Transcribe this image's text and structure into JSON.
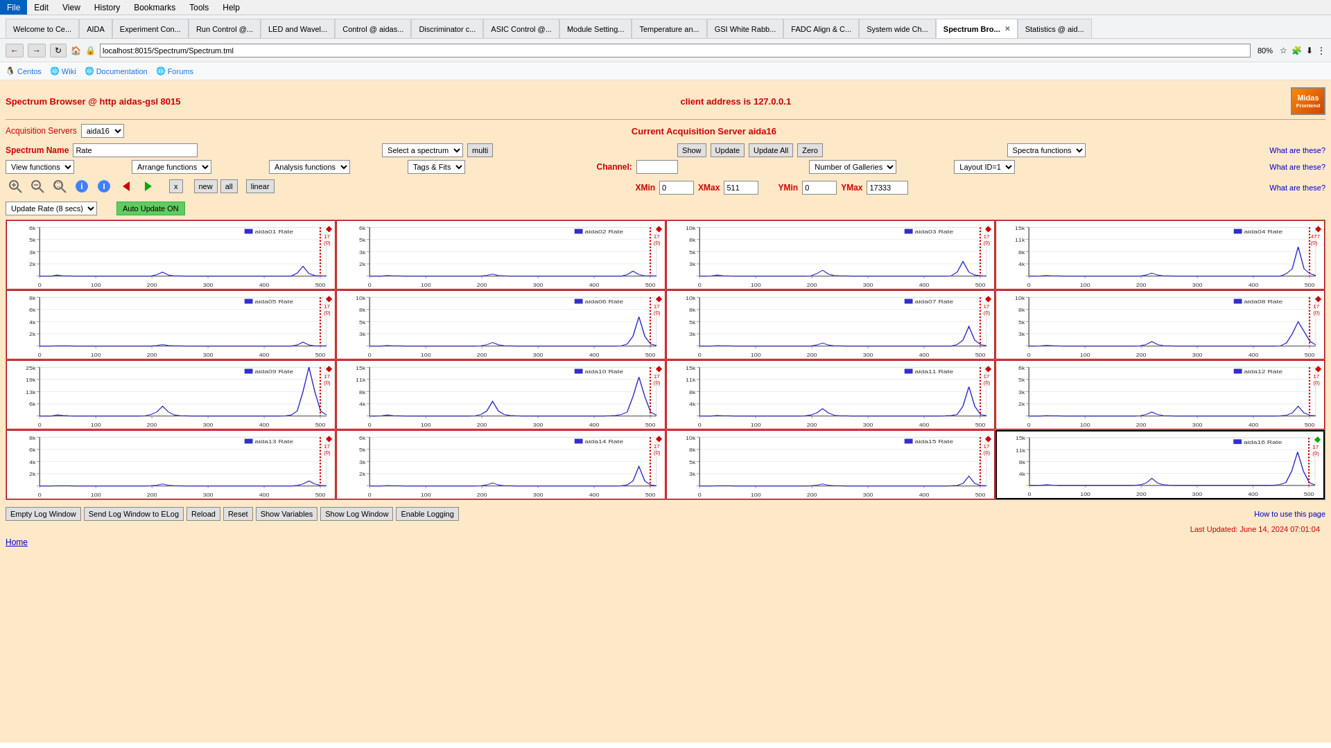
{
  "menu": {
    "items": [
      "File",
      "Edit",
      "View",
      "History",
      "Bookmarks",
      "Tools",
      "Help"
    ]
  },
  "tabs": [
    {
      "label": "Welcome to Ce...",
      "active": false
    },
    {
      "label": "AIDA",
      "active": false
    },
    {
      "label": "Experiment Con...",
      "active": false
    },
    {
      "label": "Run Control @...",
      "active": false
    },
    {
      "label": "LED and Wavel...",
      "active": false
    },
    {
      "label": "Control @ aidas...",
      "active": false
    },
    {
      "label": "Discriminator c...",
      "active": false
    },
    {
      "label": "ASIC Control @...",
      "active": false
    },
    {
      "label": "Module Setting...",
      "active": false
    },
    {
      "label": "Temperature an...",
      "active": false
    },
    {
      "label": "GSI White Rabb...",
      "active": false
    },
    {
      "label": "FADC Align & C...",
      "active": false
    },
    {
      "label": "System wide Ch...",
      "active": false
    },
    {
      "label": "Spectrum Bro...",
      "active": true,
      "closable": true
    },
    {
      "label": "Statistics @ aid...",
      "active": false
    }
  ],
  "nav": {
    "url": "localhost:8015/Spectrum/Spectrum.tml",
    "zoom": "80%"
  },
  "bookmarks": [
    {
      "label": "Centos"
    },
    {
      "label": "Wiki"
    },
    {
      "label": "Documentation"
    },
    {
      "label": "Forums"
    }
  ],
  "page": {
    "title": "Spectrum Browser @ http aidas-gsl 8015",
    "client_address": "client address is 127.0.0.1",
    "acq_label": "Acquisition Servers",
    "acq_server_select": "aida16",
    "current_acq": "Current Acquisition Server aida16",
    "spectrum_name_label": "Spectrum Name",
    "spectrum_name_value": "Rate",
    "select_spectrum": "Select a spectrum",
    "multi_btn": "multi",
    "show_btn": "Show",
    "update_btn": "Update",
    "update_all_btn": "Update All",
    "zero_btn": "Zero",
    "spectra_functions": "Spectra functions",
    "what_these1": "What are these?",
    "view_functions": "View functions",
    "arrange_functions": "Arrange functions",
    "analysis_functions": "Analysis functions",
    "tags_fits": "Tags & Fits",
    "channel_label": "Channel:",
    "channel_value": "",
    "number_galleries": "Number of Galleries",
    "layout_id": "Layout ID=1",
    "what_these2": "What are these?",
    "xmin_label": "XMin",
    "xmin_value": "0",
    "xmax_label": "XMax",
    "xmax_value": "511",
    "ymin_label": "YMin",
    "ymin_value": "0",
    "ymax_label": "YMax",
    "ymax_value": "17333",
    "what_these3": "What are these?",
    "update_rate": "Update Rate (8 secs)",
    "auto_update": "Auto Update ON",
    "btn_x": "x",
    "btn_new": "new",
    "btn_all": "all",
    "btn_linear": "linear",
    "bottom_btns": [
      "Empty Log Window",
      "Send Log Window to ELog",
      "Reload",
      "Reset",
      "Show Variables",
      "Show Log Window",
      "Enable Logging"
    ],
    "how_to": "How to use this page",
    "last_updated": "Last Updated: June 14, 2024 07:01:04",
    "home": "Home",
    "statistics_aid": "Statistics aid"
  },
  "charts": [
    {
      "id": "aida01",
      "title": "aida01 Rate",
      "ymax": 6000,
      "diamond_color": "red",
      "counter": "17\n(0)"
    },
    {
      "id": "aida02",
      "title": "aida02 Rate",
      "ymax": 6000,
      "diamond_color": "red",
      "counter": "17\n(0)"
    },
    {
      "id": "aida03",
      "title": "aida03 Rate",
      "ymax": 10000,
      "diamond_color": "red",
      "counter": "17\n(0)"
    },
    {
      "id": "aida04",
      "title": "aida04 Rate",
      "ymax": 15000,
      "diamond_color": "red",
      "counter": "477\n(0)"
    },
    {
      "id": "aida05",
      "title": "aida05 Rate",
      "ymax": 7500,
      "diamond_color": "red",
      "counter": "17\n(0)"
    },
    {
      "id": "aida06",
      "title": "aida06 Rate",
      "ymax": 10000,
      "diamond_color": "red",
      "counter": "17\n(0)"
    },
    {
      "id": "aida07",
      "title": "aida07 Rate",
      "ymax": 10000,
      "diamond_color": "red",
      "counter": "17\n(0)"
    },
    {
      "id": "aida08",
      "title": "aida08 Rate",
      "ymax": 10000,
      "diamond_color": "red",
      "counter": "17\n(0)"
    },
    {
      "id": "aida09",
      "title": "aida09 Rate",
      "ymax": 25000,
      "diamond_color": "red",
      "counter": "17\n(0)"
    },
    {
      "id": "aida10",
      "title": "aida10 Rate",
      "ymax": 15000,
      "diamond_color": "red",
      "counter": "17\n(0)"
    },
    {
      "id": "aida11",
      "title": "aida11 Rate",
      "ymax": 15000,
      "diamond_color": "red",
      "counter": "17\n(0)"
    },
    {
      "id": "aida12",
      "title": "aida12 Rate",
      "ymax": 6000,
      "diamond_color": "red",
      "counter": "17\n(0)"
    },
    {
      "id": "aida13",
      "title": "aida13 Rate",
      "ymax": 7500,
      "diamond_color": "red",
      "counter": "17\n(0)"
    },
    {
      "id": "aida14",
      "title": "aida14 Rate",
      "ymax": 6000,
      "diamond_color": "red",
      "counter": "17\n(0)"
    },
    {
      "id": "aida15",
      "title": "aida15 Rate",
      "ymax": 10000,
      "diamond_color": "red",
      "counter": "17\n(0)"
    },
    {
      "id": "aida16",
      "title": "aida16 Rate",
      "ymax": 15000,
      "diamond_color": "green",
      "counter": "17\n(0)",
      "selected": true
    }
  ]
}
